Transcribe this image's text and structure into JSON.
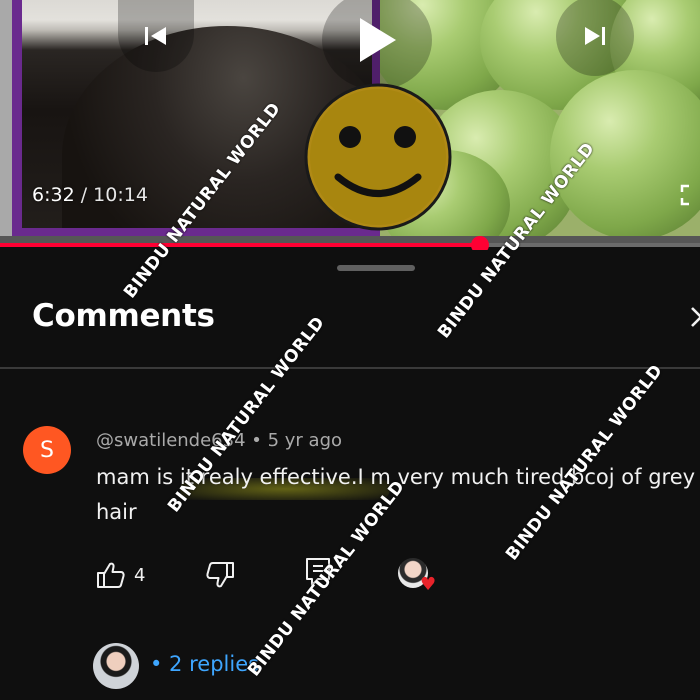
{
  "player": {
    "current_time": "6:32",
    "separator": " / ",
    "duration": "10:14",
    "progress": 0.639,
    "controls": {
      "previous_icon": "skip-previous-icon",
      "play_icon": "play-icon",
      "next_icon": "skip-next-icon",
      "fullscreen_icon": "fullscreen-icon"
    },
    "overlay_sticker": "smiley-face"
  },
  "comments_panel": {
    "title": "Comments",
    "close_icon": "close-icon",
    "comment": {
      "avatar_letter": "S",
      "avatar_color": "#ff5722",
      "author": "@swatilende634",
      "bullet": " • ",
      "age": "5 yr ago",
      "text": "mam is it realy effective.I m very much tired bcoj of grey hair",
      "like_count": "4",
      "actions": [
        "like-icon",
        "dislike-icon",
        "reply-icon",
        "creator-heart-icon"
      ],
      "replies_label": "• 2 replies",
      "replies_color": "#3ea6ff"
    }
  },
  "watermark": "BINDU NATURAL WORLD",
  "colors": {
    "background": "#0f0f0f",
    "progress": "#ff0033",
    "heart": "#e8232a"
  }
}
